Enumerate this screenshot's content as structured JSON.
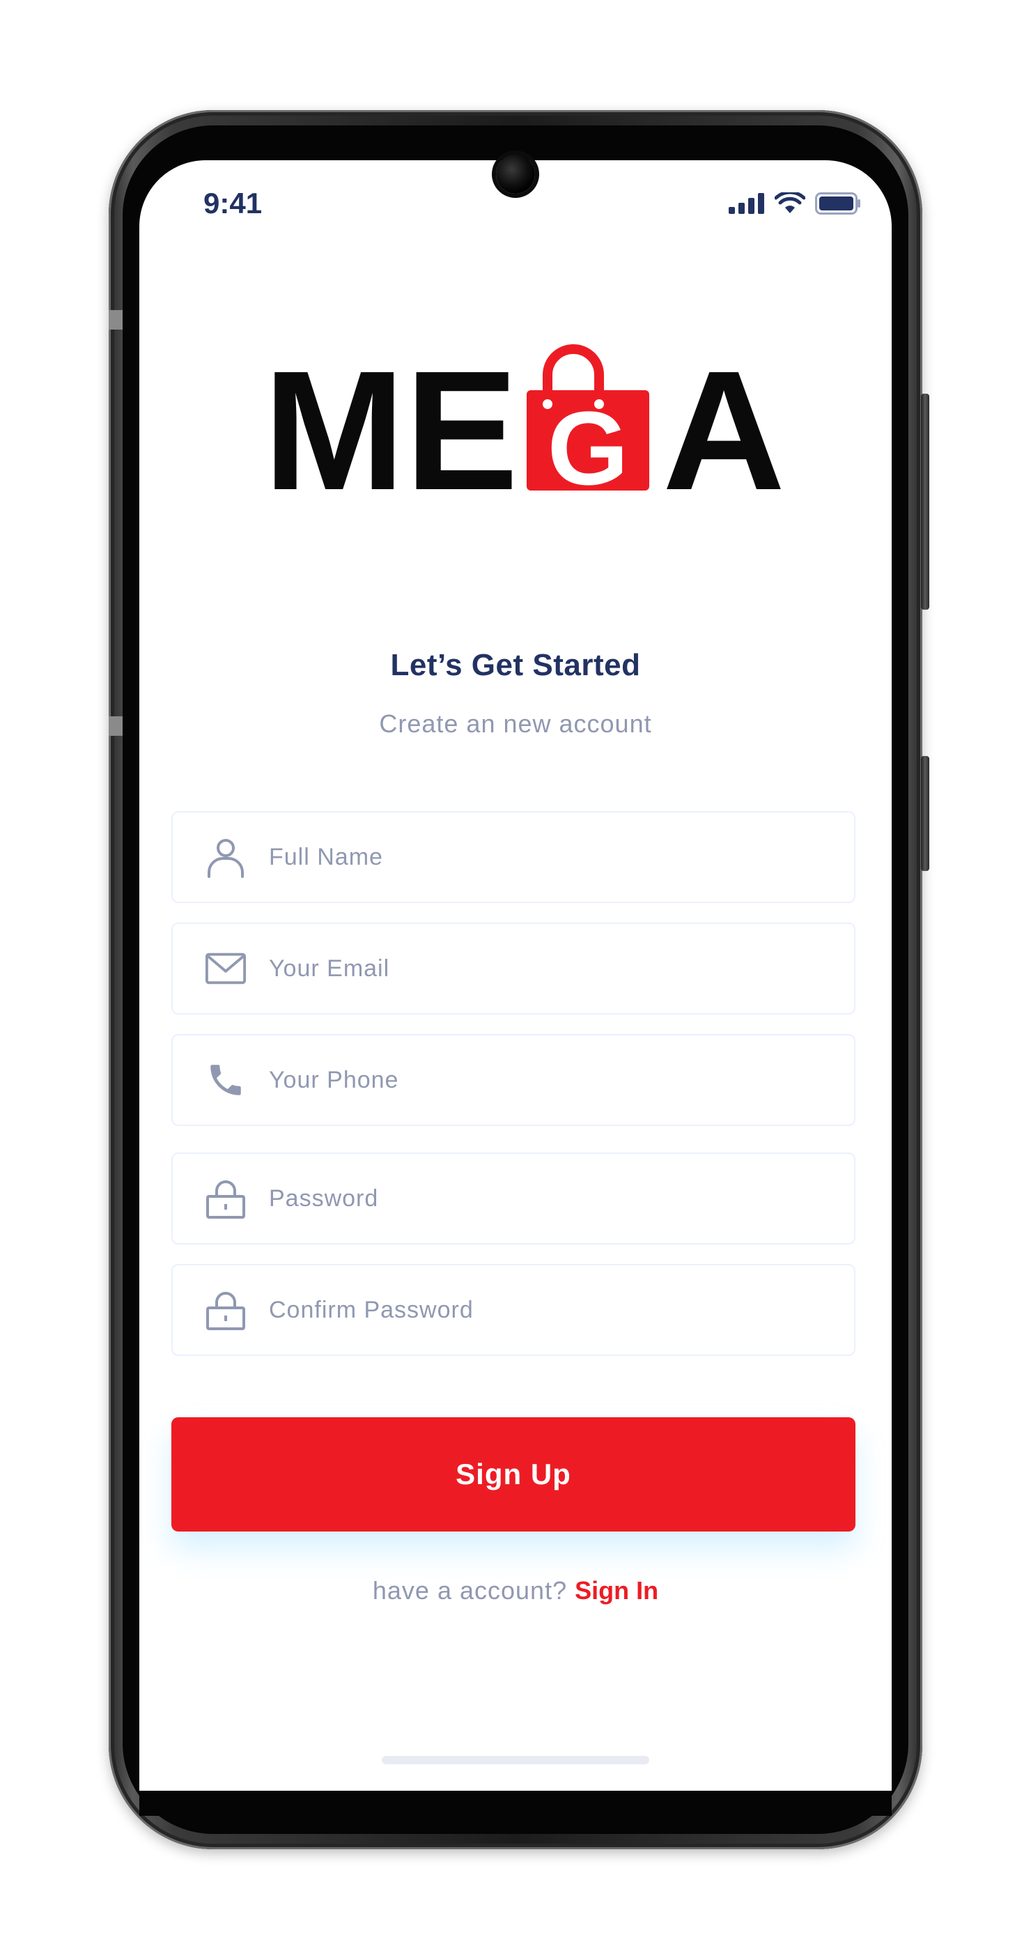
{
  "status_bar": {
    "time": "9:41",
    "icons": [
      "cellular-signal-icon",
      "wifi-icon",
      "battery-icon"
    ]
  },
  "logo": {
    "text": "MEGA",
    "icon": "shopping-bag-icon"
  },
  "header": {
    "title": "Let’s Get Started",
    "subtitle": "Create an new account"
  },
  "form": {
    "full_name": {
      "placeholder": "Full Name",
      "value": "",
      "icon": "user-icon"
    },
    "email": {
      "placeholder": "Your Email",
      "value": "",
      "icon": "mail-icon"
    },
    "phone": {
      "placeholder": "Your Phone",
      "value": "",
      "icon": "phone-icon"
    },
    "password": {
      "placeholder": "Password",
      "value": "",
      "icon": "lock-icon"
    },
    "confirm_password": {
      "placeholder": "Confirm Password",
      "value": "",
      "icon": "lock-icon"
    }
  },
  "actions": {
    "signup_label": "Sign Up",
    "have_account_text": "have a account?",
    "signin_label": "Sign In"
  },
  "colors": {
    "primary": "#ED1C24",
    "heading": "#223263",
    "muted": "#9098B1",
    "field_border": "#EBF0FF"
  }
}
